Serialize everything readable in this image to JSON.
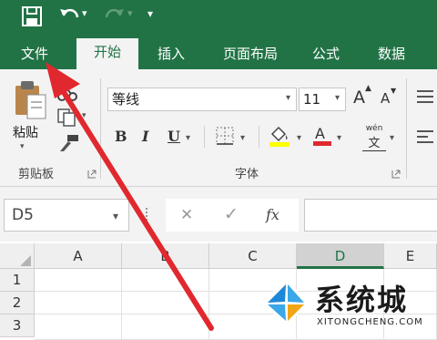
{
  "quick_access": {
    "icons": [
      "save-icon",
      "undo-icon",
      "redo-icon",
      "customize-icon"
    ],
    "undo_caret": "▾",
    "redo_caret": "▾",
    "customize_glyph": "▾"
  },
  "tabs": [
    {
      "label": "文件"
    },
    {
      "label": "开始"
    },
    {
      "label": "插入"
    },
    {
      "label": "页面布局"
    },
    {
      "label": "公式"
    },
    {
      "label": "数据"
    }
  ],
  "ribbon": {
    "paste_label": "粘贴",
    "clipboard_group": "剪贴板",
    "font_group": "字体",
    "font_name": "等线",
    "font_size": "11",
    "bold": "B",
    "italic": "I",
    "underline": "U",
    "grow_font": "A",
    "shrink_font": "A",
    "phonetic_top": "wén",
    "phonetic_bottom": "文"
  },
  "formula_bar": {
    "name_box": "D5",
    "cancel": "✕",
    "enter": "✓",
    "fx": "fx"
  },
  "sheet": {
    "columns": [
      "A",
      "B",
      "C",
      "D",
      "E"
    ],
    "rows": [
      "1",
      "2",
      "3"
    ],
    "selected_column": "D"
  },
  "watermark": {
    "brand_text": "系统城",
    "url": "XITONGCHENG.COM"
  },
  "colors": {
    "brand_green": "#217346",
    "arrow_red": "#e0282e",
    "fill_yellow": "#ffff00",
    "font_red": "#e0282e"
  }
}
